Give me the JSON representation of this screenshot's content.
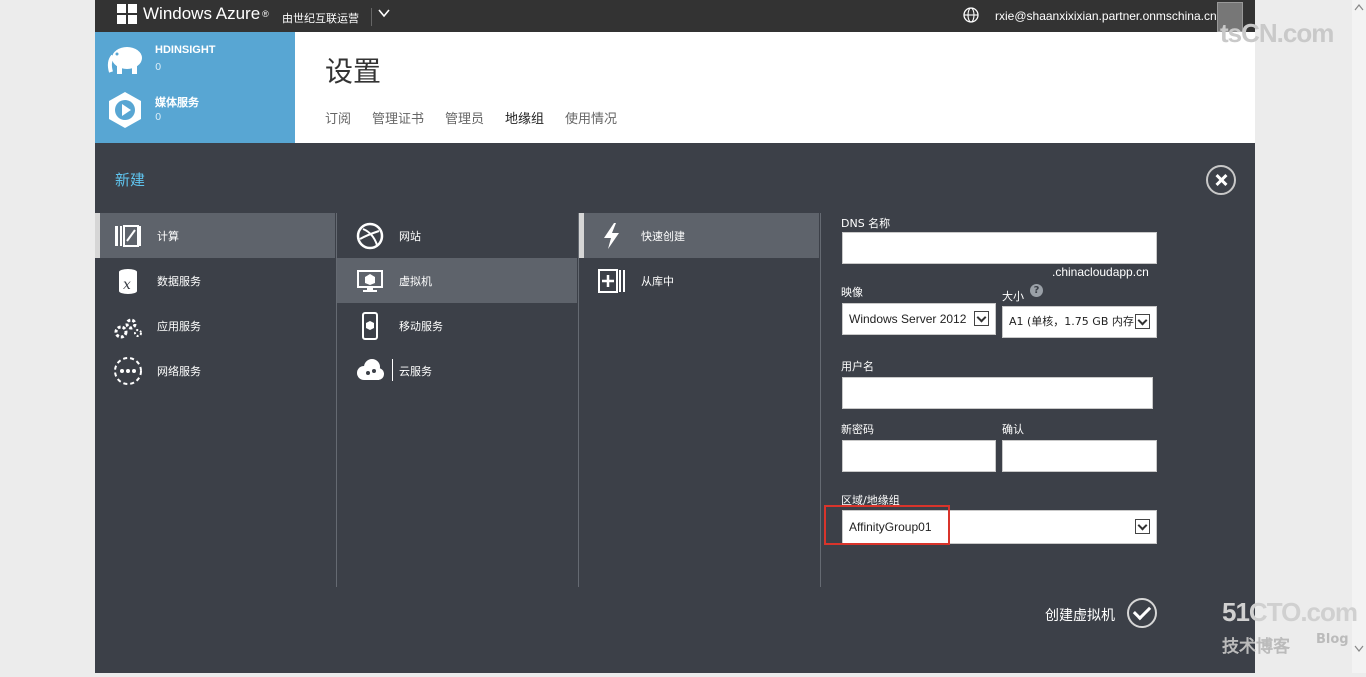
{
  "topbar": {
    "brand": "Windows Azure",
    "brand_mark": "®",
    "subscription": "由世纪互联运营",
    "email": "rxie@shaanxixixian.partner.onmschina.cn"
  },
  "sidebar": {
    "items": [
      {
        "label": "HDINSIGHT",
        "count": "0",
        "icon": "elephant-icon"
      },
      {
        "label": "媒体服务",
        "count": "0",
        "icon": "media-icon"
      }
    ]
  },
  "settings": {
    "title": "设置",
    "tabs": [
      "订阅",
      "管理证书",
      "管理员",
      "地缘组",
      "使用情况"
    ],
    "active_tab": "地缘组"
  },
  "new_panel": {
    "title": "新建",
    "column1": [
      {
        "label": "计算",
        "icon": "compute-icon",
        "active": true
      },
      {
        "label": "数据服务",
        "icon": "data-icon"
      },
      {
        "label": "应用服务",
        "icon": "app-services-icon"
      },
      {
        "label": "网络服务",
        "icon": "network-icon"
      }
    ],
    "column2": [
      {
        "label": "网站",
        "icon": "website-icon"
      },
      {
        "label": "虚拟机",
        "icon": "vm-icon",
        "active": true
      },
      {
        "label": "移动服务",
        "icon": "mobile-icon"
      },
      {
        "label": "云服务",
        "icon": "cloud-icon"
      }
    ],
    "column3": [
      {
        "label": "快速创建",
        "icon": "lightning-icon",
        "active": true
      },
      {
        "label": "从库中",
        "icon": "gallery-icon"
      }
    ],
    "form": {
      "dns_label": "DNS 名称",
      "dns_value": "",
      "dns_suffix": ".chinacloudapp.cn",
      "image_label": "映像",
      "image_value": "Windows Server 2012",
      "size_label": "大小",
      "size_value": "A1 (单核，1.75 GB 内存",
      "username_label": "用户名",
      "username_value": "",
      "password_label": "新密码",
      "password_value": "",
      "confirm_label": "确认",
      "confirm_value": "",
      "region_label": "区域/地缘组",
      "region_value": "AffinityGroup01"
    },
    "create_label": "创建虚拟机"
  },
  "watermark": {
    "top": "tsCN.com",
    "logo": "51CTO.com",
    "sub": "技术博客",
    "blog": "Blog"
  },
  "colors": {
    "panel_bg": "#3c4048",
    "sidebar_bg": "#58a6d3",
    "accent": "#5fc4ee",
    "highlight": "#d9342b"
  }
}
